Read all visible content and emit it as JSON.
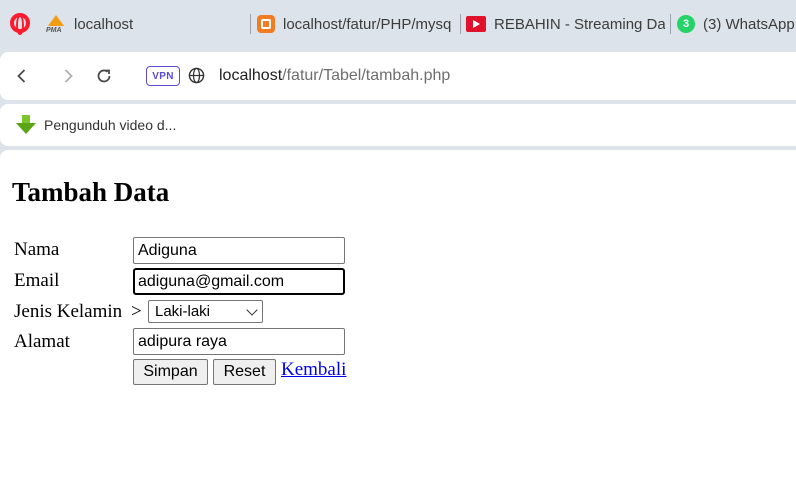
{
  "tabs": [
    {
      "label": "localhost",
      "icon": "phpmyadmin-icon",
      "icon_text": "PMA"
    },
    {
      "label": "localhost/fatur/PHP/mysq",
      "icon": "xampp-icon"
    },
    {
      "label": "REBAHIN - Streaming Dan",
      "icon": "rebahin-icon"
    },
    {
      "label": "(3) WhatsApp",
      "icon": "whatsapp-icon",
      "badge": "3"
    }
  ],
  "toolbar": {
    "vpn_label": "VPN",
    "url_host": "localhost",
    "url_path": "/fatur/Tabel/tambah.php"
  },
  "bookmarks": [
    {
      "label": "Pengunduh video d..."
    }
  ],
  "form": {
    "title": "Tambah Data",
    "fields": {
      "nama": {
        "label": "Nama",
        "value": "Adiguna"
      },
      "email": {
        "label": "Email",
        "value": "adiguna@gmail.com"
      },
      "jenis_kelamin": {
        "label": "Jenis Kelamin",
        "suffix": ">",
        "value": "Laki-laki"
      },
      "alamat": {
        "label": "Alamat",
        "value": "adipura raya"
      }
    },
    "buttons": {
      "simpan": "Simpan",
      "reset": "Reset"
    },
    "link": "Kembali"
  },
  "colors": {
    "chrome_bg": "#dde3ea",
    "vpn_accent": "#5b4bd5",
    "link": "#0000ee",
    "opera_red": "#ff1b2d"
  }
}
